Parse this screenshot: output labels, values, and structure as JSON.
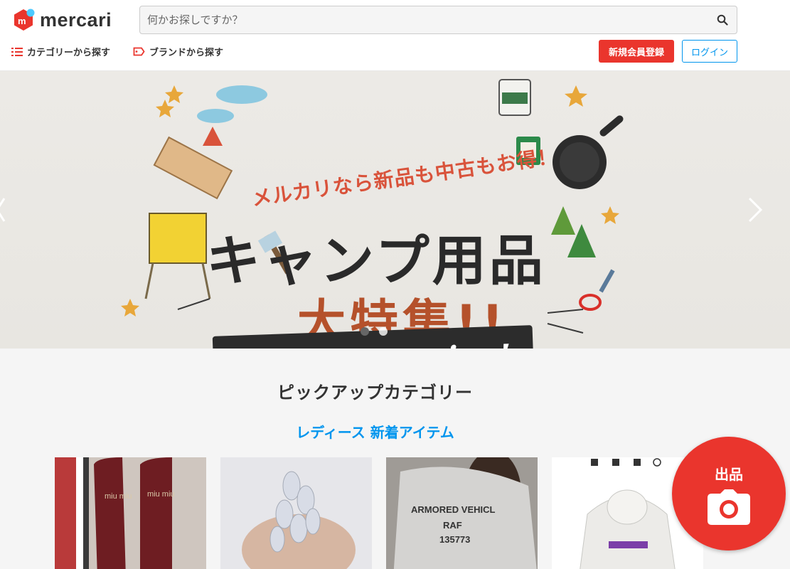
{
  "brand": {
    "name": "mercari"
  },
  "search": {
    "placeholder": "何かお探しですか？"
  },
  "nav": {
    "category_label": "カテゴリーから探す",
    "brand_label": "ブランドから探す"
  },
  "auth": {
    "register_label": "新規会員登録",
    "login_label": "ログイン"
  },
  "banner": {
    "tagline": "メルカリなら新品も中古もお得！",
    "title": "キャンプ用品",
    "subtitle": "大特集!!",
    "ribbon": "let's go camping!",
    "active_slide": 1,
    "slide_count": 2
  },
  "section": {
    "title": "ピックアップカテゴリー",
    "subtitle": "レディース 新着アイテム"
  },
  "items": [
    {
      "name": "item-shoes",
      "label": "miu miu"
    },
    {
      "name": "item-hair-accessory"
    },
    {
      "name": "item-tshirt",
      "label": "ARMORED VEHICL RAF 135773"
    },
    {
      "name": "item-hoodie"
    }
  ],
  "sell_button": {
    "label": "出品"
  },
  "colors": {
    "accent": "#ea352d",
    "link": "#0095ee"
  }
}
